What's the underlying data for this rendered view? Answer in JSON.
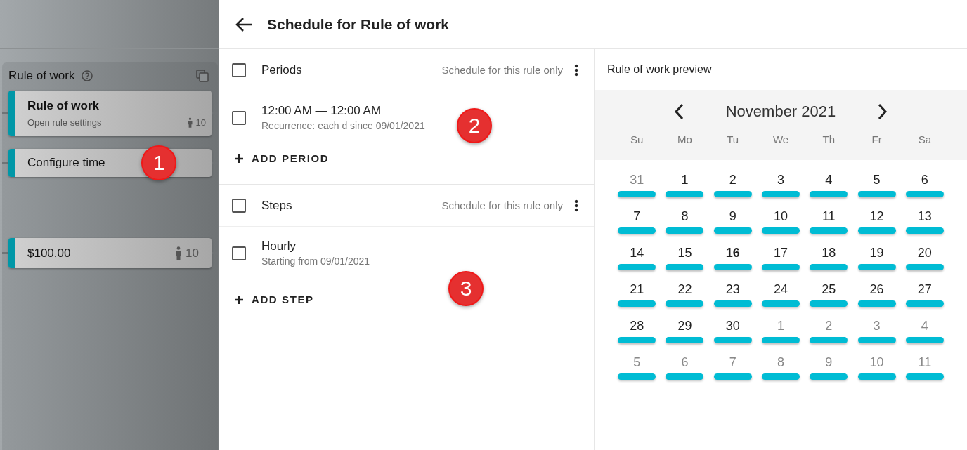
{
  "sidebar": {
    "title": "Rule of work",
    "cards": [
      {
        "kind": "rule",
        "title": "Rule of work",
        "subtitle": "Open rule settings",
        "count": "10"
      },
      {
        "kind": "step",
        "title": "Configure time"
      },
      {
        "kind": "amount",
        "title": "$100.00",
        "count": "10"
      }
    ]
  },
  "header": {
    "title": "Schedule for Rule of work"
  },
  "sections": [
    {
      "title": "Periods",
      "checked": false,
      "note": "Schedule for this rule only",
      "items": [
        {
          "title": "12:00 AM — 12:00 AM",
          "subtitle": "Recurrence: each d since 09/01/2021",
          "checked": false
        }
      ],
      "add_label": "ADD PERIOD"
    },
    {
      "title": "Steps",
      "checked": false,
      "note": "Schedule for this rule only",
      "items": [
        {
          "title": "Hourly",
          "subtitle": "Starting from 09/01/2021",
          "checked": false
        }
      ],
      "add_label": "ADD STEP"
    }
  ],
  "preview": {
    "title": "Rule of work preview",
    "month": "November 2021",
    "weekdays": [
      "Su",
      "Mo",
      "Tu",
      "We",
      "Th",
      "Fr",
      "Sa"
    ],
    "weeks": [
      [
        {
          "day": "31",
          "outside": true,
          "today": false
        },
        {
          "day": "1",
          "outside": false,
          "today": false
        },
        {
          "day": "2",
          "outside": false,
          "today": false
        },
        {
          "day": "3",
          "outside": false,
          "today": false
        },
        {
          "day": "4",
          "outside": false,
          "today": false
        },
        {
          "day": "5",
          "outside": false,
          "today": false
        },
        {
          "day": "6",
          "outside": false,
          "today": false
        }
      ],
      [
        {
          "day": "7",
          "outside": false,
          "today": false
        },
        {
          "day": "8",
          "outside": false,
          "today": false
        },
        {
          "day": "9",
          "outside": false,
          "today": false
        },
        {
          "day": "10",
          "outside": false,
          "today": false
        },
        {
          "day": "11",
          "outside": false,
          "today": false
        },
        {
          "day": "12",
          "outside": false,
          "today": false
        },
        {
          "day": "13",
          "outside": false,
          "today": false
        }
      ],
      [
        {
          "day": "14",
          "outside": false,
          "today": false
        },
        {
          "day": "15",
          "outside": false,
          "today": false
        },
        {
          "day": "16",
          "outside": false,
          "today": true
        },
        {
          "day": "17",
          "outside": false,
          "today": false
        },
        {
          "day": "18",
          "outside": false,
          "today": false
        },
        {
          "day": "19",
          "outside": false,
          "today": false
        },
        {
          "day": "20",
          "outside": false,
          "today": false
        }
      ],
      [
        {
          "day": "21",
          "outside": false,
          "today": false
        },
        {
          "day": "22",
          "outside": false,
          "today": false
        },
        {
          "day": "23",
          "outside": false,
          "today": false
        },
        {
          "day": "24",
          "outside": false,
          "today": false
        },
        {
          "day": "25",
          "outside": false,
          "today": false
        },
        {
          "day": "26",
          "outside": false,
          "today": false
        },
        {
          "day": "27",
          "outside": false,
          "today": false
        }
      ],
      [
        {
          "day": "28",
          "outside": false,
          "today": false
        },
        {
          "day": "29",
          "outside": false,
          "today": false
        },
        {
          "day": "30",
          "outside": false,
          "today": false
        },
        {
          "day": "1",
          "outside": true,
          "today": false
        },
        {
          "day": "2",
          "outside": true,
          "today": false
        },
        {
          "day": "3",
          "outside": true,
          "today": false
        },
        {
          "day": "4",
          "outside": true,
          "today": false
        }
      ],
      [
        {
          "day": "5",
          "outside": true,
          "today": false
        },
        {
          "day": "6",
          "outside": true,
          "today": false
        },
        {
          "day": "7",
          "outside": true,
          "today": false
        },
        {
          "day": "8",
          "outside": true,
          "today": false
        },
        {
          "day": "9",
          "outside": true,
          "today": false
        },
        {
          "day": "10",
          "outside": true,
          "today": false
        },
        {
          "day": "11",
          "outside": true,
          "today": false
        }
      ]
    ]
  },
  "callouts": [
    "1",
    "2",
    "3"
  ]
}
